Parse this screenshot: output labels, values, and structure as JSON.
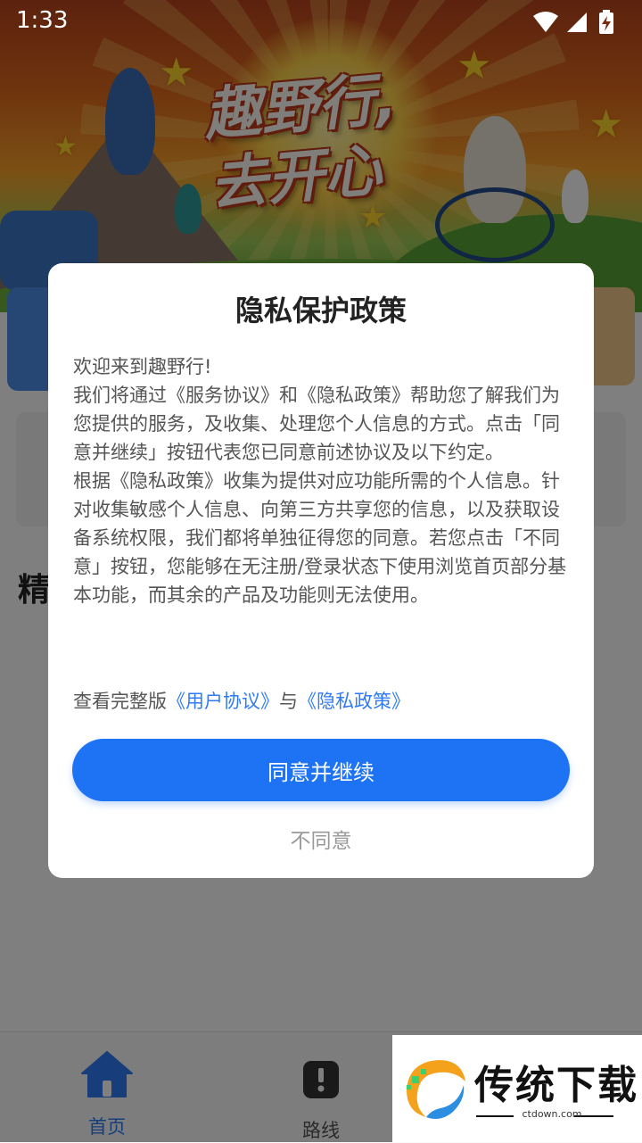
{
  "status_bar": {
    "time": "1:33",
    "icons": [
      "wifi-icon",
      "signal-icon",
      "battery-charging-icon"
    ]
  },
  "banner": {
    "headline_line1": "趣野行,",
    "headline_line2": "去开心"
  },
  "page": {
    "section_title": "精"
  },
  "dialog": {
    "title": "隐私保护政策",
    "paragraphs": [
      "欢迎来到趣野行!",
      "我们将通过《服务协议》和《隐私政策》帮助您了解我们为您提供的服务，及收集、处理您个人信息的方式。点击「同意并继续」按钮代表您已同意前述协议及以下约定。",
      "根据《隐私政策》收集为提供对应功能所需的个人信息。针对收集敏感个人信息、向第三方共享您的信息，以及获取设备系统权限，我们都将单独征得您的同意。若您点击「不同意」按钮，您能够在无注册/登录状态下使用浏览首页部分基本功能，而其余的产品及功能则无法使用。"
    ],
    "links_prefix": "查看完整版",
    "user_agreement_link": "《用户协议》",
    "links_joiner": "与",
    "privacy_policy_link": "《隐私政策》",
    "agree_label": "同意并继续",
    "disagree_label": "不同意"
  },
  "bottom_nav": {
    "items": [
      {
        "label": "首页",
        "icon": "home-icon",
        "active": true
      },
      {
        "label": "路线",
        "icon": "route-icon",
        "active": false
      }
    ]
  },
  "watermark": {
    "text": "传统下载",
    "sub": "ctdown.com"
  },
  "colors": {
    "accent": "#1e73f5",
    "link": "#2f7bf6",
    "muted": "#999999"
  }
}
